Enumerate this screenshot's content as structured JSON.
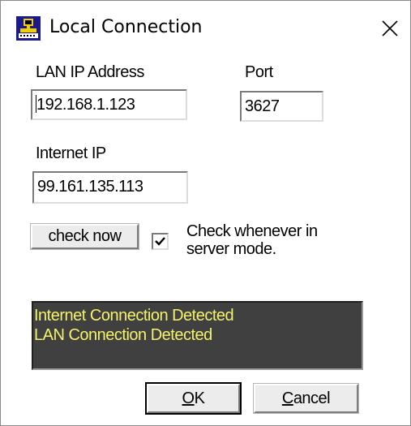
{
  "window": {
    "title": "Local Connection",
    "icon": "network-computer-icon",
    "close_icon": "close-icon"
  },
  "lan": {
    "label": "LAN IP Address",
    "value": "192.168.1.123"
  },
  "port": {
    "label": "Port",
    "value": "3627"
  },
  "internet": {
    "label": "Internet IP",
    "value": "99.161.135.113"
  },
  "check_now_label": "check now",
  "server_mode": {
    "checked": true,
    "label_line1": "Check whenever in",
    "label_line2": "server mode."
  },
  "status": {
    "lines": [
      "Internet Connection Detected",
      "LAN Connection Detected"
    ],
    "text_color": "#f5f26b",
    "background": "#404040"
  },
  "buttons": {
    "ok_mnemonic": "O",
    "ok_rest": "K",
    "cancel_mnemonic": "C",
    "cancel_rest": "ancel"
  }
}
